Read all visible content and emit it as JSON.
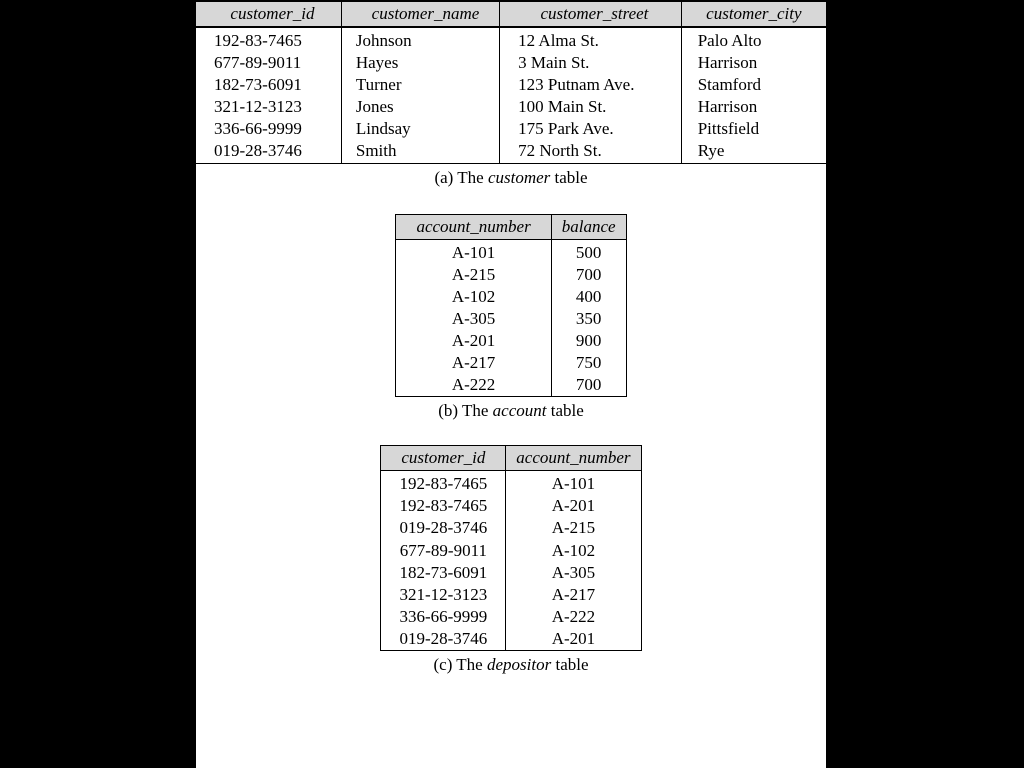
{
  "customer": {
    "headers": [
      "customer_id",
      "customer_name",
      "customer_street",
      "customer_city"
    ],
    "rows": [
      [
        "192-83-7465",
        "Johnson",
        "12 Alma St.",
        "Palo Alto"
      ],
      [
        "677-89-9011",
        "Hayes",
        "3 Main St.",
        "Harrison"
      ],
      [
        "182-73-6091",
        "Turner",
        "123 Putnam Ave.",
        "Stamford"
      ],
      [
        "321-12-3123",
        "Jones",
        "100 Main St.",
        "Harrison"
      ],
      [
        "336-66-9999",
        "Lindsay",
        "175 Park Ave.",
        "Pittsfield"
      ],
      [
        "019-28-3746",
        "Smith",
        "72 North St.",
        "Rye"
      ]
    ],
    "caption_prefix": "(a) The ",
    "caption_em": "customer",
    "caption_suffix": " table"
  },
  "account": {
    "headers": [
      "account_number",
      "balance"
    ],
    "rows": [
      [
        "A-101",
        "500"
      ],
      [
        "A-215",
        "700"
      ],
      [
        "A-102",
        "400"
      ],
      [
        "A-305",
        "350"
      ],
      [
        "A-201",
        "900"
      ],
      [
        "A-217",
        "750"
      ],
      [
        "A-222",
        "700"
      ]
    ],
    "caption_prefix": "(b) The ",
    "caption_em": "account",
    "caption_suffix": " table"
  },
  "depositor": {
    "headers": [
      "customer_id",
      "account_number"
    ],
    "rows": [
      [
        "192-83-7465",
        "A-101"
      ],
      [
        "192-83-7465",
        "A-201"
      ],
      [
        "019-28-3746",
        "A-215"
      ],
      [
        "677-89-9011",
        "A-102"
      ],
      [
        "182-73-6091",
        "A-305"
      ],
      [
        "321-12-3123",
        "A-217"
      ],
      [
        "336-66-9999",
        "A-222"
      ],
      [
        "019-28-3746",
        "A-201"
      ]
    ],
    "caption_prefix": "(c) The ",
    "caption_em": "depositor",
    "caption_suffix": " table"
  }
}
